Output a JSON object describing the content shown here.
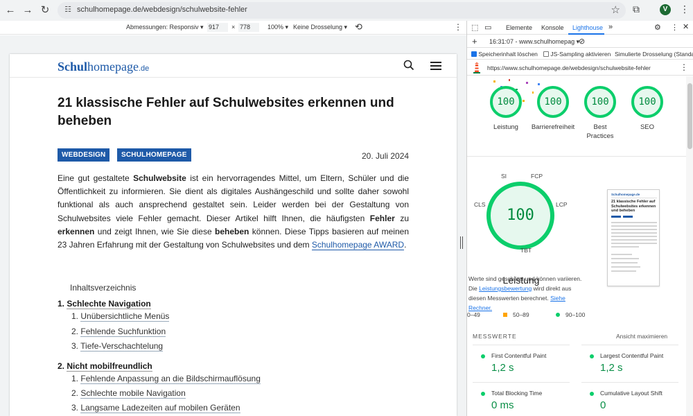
{
  "browser": {
    "url": "schulhomepage.de/webdesign/schulwebsite-fehler",
    "profile_initial": "V"
  },
  "device_toolbar": {
    "dimensions_label": "Abmessungen: Responsiv ▾",
    "width": "917",
    "times": "×",
    "height": "778",
    "zoom": "100% ▾",
    "throttle": "Keine Drosselung ▾"
  },
  "site": {
    "logo_bold": "Schul",
    "logo_rest": "homepage",
    "logo_tld": ".de"
  },
  "article": {
    "title": "21 klassische Fehler auf Schulwebsites erkennen und beheben",
    "tags": [
      "WEBDESIGN",
      "SCHULHOMEPAGE"
    ],
    "date": "20. Juli 2024",
    "intro_1": "Eine gut gestaltete ",
    "intro_b1": "Schulwebsite",
    "intro_2": " ist ein hervorragendes Mittel, um Eltern, Schüler und die Öffentlichkeit zu informieren. Sie dient als digitales Aushängeschild und sollte daher sowohl funktional als auch ansprechend gestaltet sein. Leider werden bei der Gestaltung von Schulwebsites viele Fehler gemacht. Dieser Artikel hilft Ihnen, die häufigsten ",
    "intro_b2": "Fehler",
    "intro_3": " zu ",
    "intro_b3": "erkennen",
    "intro_4": " und zeigt Ihnen, wie Sie diese ",
    "intro_b4": "beheben",
    "intro_5": " können. Diese Tipps basieren auf meinen 23 Jahren Erfahrung mit der Gestaltung von Schulwebsites und dem ",
    "intro_link": "Schulhomepage AWARD",
    "intro_end": "."
  },
  "toc": {
    "title": "Inhaltsverzeichnis",
    "sections": [
      {
        "num": "1.",
        "label": "Schlechte Navigation",
        "items": [
          {
            "num": "1.",
            "label": "Unübersichtliche Menüs"
          },
          {
            "num": "2.",
            "label": "Fehlende Suchfunktion"
          },
          {
            "num": "3.",
            "label": "Tiefe-Verschachtelung"
          }
        ]
      },
      {
        "num": "2.",
        "label": "Nicht mobilfreundlich",
        "items": [
          {
            "num": "1.",
            "label": "Fehlende Anpassung an die Bildschirmauflösung"
          },
          {
            "num": "2.",
            "label": "Schlechte mobile Navigation"
          },
          {
            "num": "3.",
            "label": "Langsame Ladezeiten auf mobilen Geräten"
          }
        ]
      }
    ]
  },
  "devtools": {
    "tabs": [
      "Elemente",
      "Konsole",
      "Lighthouse"
    ],
    "more": "»",
    "report_select": "16:31:07 - www.schulhomepag ▾",
    "clear_storage": "Speicherinhalt löschen",
    "js_sampling": "JS-Sampling aktivieren",
    "throttling": "Simulierte Drosselung (Standa",
    "audited_url": "https://www.schulhomepage.de/webdesign/schulwebsite-fehler",
    "scores": [
      {
        "label": "Leistung",
        "value": "100"
      },
      {
        "label": "Barrierefreiheit",
        "value": "100"
      },
      {
        "label": "Best Practices",
        "value": "100"
      },
      {
        "label": "SEO",
        "value": "100"
      }
    ],
    "main_score": "100",
    "main_label": "Leistung",
    "segments": [
      "SI",
      "FCP",
      "LCP",
      "TBT",
      "CLS"
    ],
    "note_1": "Werte sind geschätzt und können variieren. Die ",
    "note_link1": "Leistungsbewertung",
    "note_2": " wird direkt aus diesen Messwerten berechnet. ",
    "note_link2": "Siehe Rechner.",
    "legend": [
      {
        "range": "0–49",
        "color": "#ff4e42"
      },
      {
        "range": "50–89",
        "color": "#ffa400"
      },
      {
        "range": "90–100",
        "color": "#0cce6b"
      }
    ],
    "metrics_header": "MESSWERTE",
    "expand_view": "Ansicht maximieren",
    "metrics": [
      {
        "name": "First Contentful Paint",
        "value": "1,2 s"
      },
      {
        "name": "Largest Contentful Paint",
        "value": "1,2 s"
      },
      {
        "name": "Total Blocking Time",
        "value": "0 ms"
      },
      {
        "name": "Cumulative Layout Shift",
        "value": "0"
      }
    ],
    "thumb": {
      "logo": "Schulhomepage.de",
      "title": "21 klassische Fehler auf Schulwebsites erkennen und beheben"
    }
  }
}
